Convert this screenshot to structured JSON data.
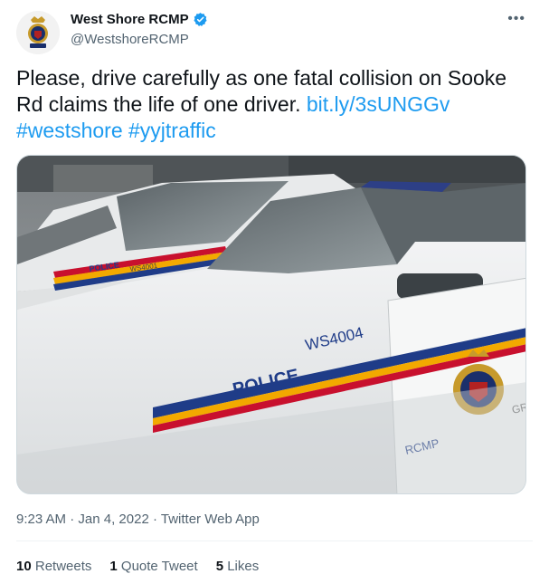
{
  "user": {
    "display_name": "West Shore RCMP",
    "handle": "@WestshoreRCMP",
    "avatar_icon": "rcmp-crest-icon",
    "verified_icon": "verified-badge-icon",
    "verified_color": "#1d9bf0"
  },
  "tweet": {
    "text": "Please, drive carefully as one fatal collision on Sooke Rd claims the life of one driver.",
    "link": "bit.ly/3sUNGGv",
    "hashtags": [
      "#westshore",
      "#yyjtraffic"
    ]
  },
  "media": {
    "car_unit_front": "WS4004",
    "car_unit_back": "WS4001",
    "police_label": "POLICE",
    "rcmp_label": "RCMP",
    "door_partial": "GR"
  },
  "meta": {
    "time": "9:23 AM",
    "separator": "·",
    "date": "Jan 4, 2022",
    "source": "Twitter Web App"
  },
  "stats": {
    "retweets_count": "10",
    "retweets_label": "Retweets",
    "quote_count": "1",
    "quote_label": "Quote Tweet",
    "likes_count": "5",
    "likes_label": "Likes"
  },
  "colors": {
    "link": "#1d9bf0",
    "muted": "#536471",
    "text": "#0f1419"
  }
}
